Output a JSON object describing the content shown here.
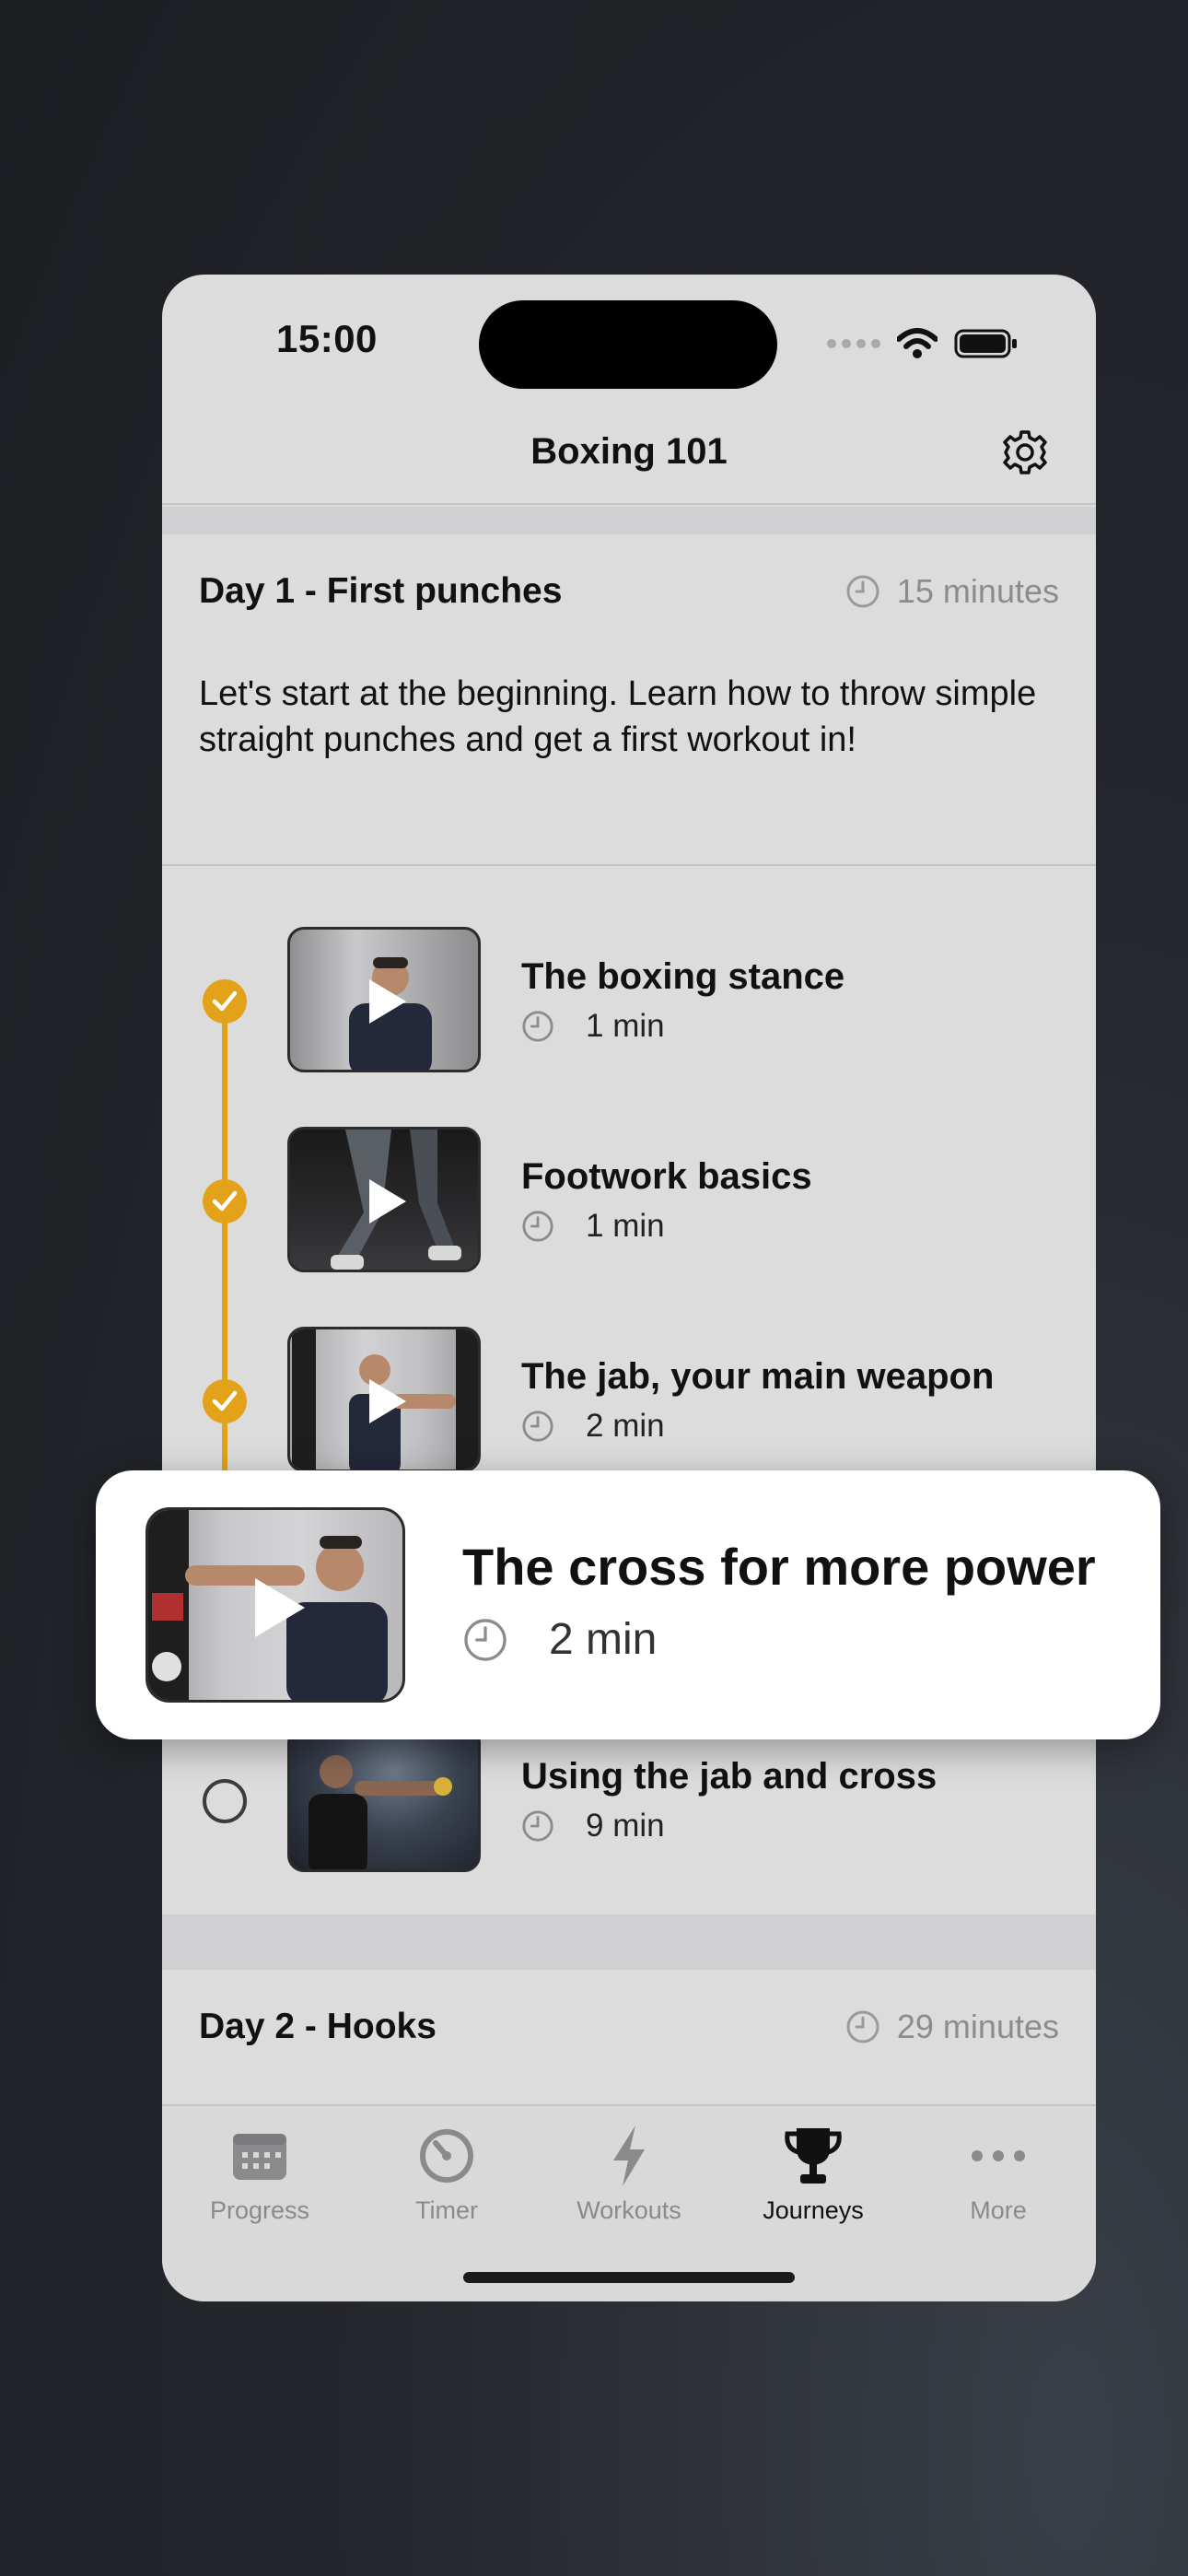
{
  "status_bar": {
    "time": "15:00"
  },
  "nav": {
    "title": "Boxing 101"
  },
  "day1": {
    "title": "Day 1 - First punches",
    "duration": "15 minutes",
    "description": "Let's start at the beginning. Learn how to throw simple straight punches and get a first workout in!"
  },
  "lessons": [
    {
      "title": "The boxing stance",
      "duration": "1 min",
      "completed": true
    },
    {
      "title": "Footwork basics",
      "duration": "1 min",
      "completed": true
    },
    {
      "title": "The jab, your main weapon",
      "duration": "2 min",
      "completed": true
    },
    {
      "title": "The cross for more power",
      "duration": "2 min",
      "completed": false
    },
    {
      "title": "Using the jab and cross",
      "duration": "9 min",
      "completed": false
    }
  ],
  "popup": {
    "title": "The cross for more power",
    "duration": "2 min"
  },
  "day2": {
    "title": "Day 2 - Hooks",
    "duration": "29 minutes"
  },
  "tabs": [
    {
      "label": "Progress",
      "icon": "calendar-icon",
      "active": false
    },
    {
      "label": "Timer",
      "icon": "timer-icon",
      "active": false
    },
    {
      "label": "Workouts",
      "icon": "lightning-icon",
      "active": false
    },
    {
      "label": "Journeys",
      "icon": "trophy-icon",
      "active": true
    },
    {
      "label": "More",
      "icon": "more-icon",
      "active": false
    }
  ],
  "colors": {
    "accent": "#e2a31b",
    "background": "#dcdcdd"
  }
}
